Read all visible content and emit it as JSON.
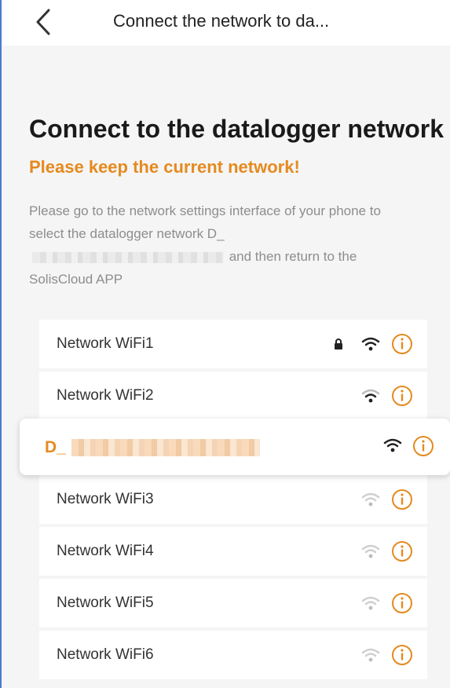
{
  "nav": {
    "title": "Connect the network to da..."
  },
  "main": {
    "heading": "Connect to the datalogger network",
    "warning": "Please keep the current network!",
    "instructions_part1": "Please go to the network settings interface of your phone to select the datalogger network D_",
    "instructions_part2": " and then return to the SolisCloud APP"
  },
  "networks": [
    {
      "label": "Network WiFi1",
      "locked": true,
      "signal_strength": "strong"
    },
    {
      "label": "Network WiFi2",
      "locked": false,
      "signal_strength": "medium"
    },
    {
      "label": "D_",
      "locked": false,
      "signal_strength": "strong",
      "selected": true
    },
    {
      "label": "Network WiFi3",
      "locked": false,
      "signal_strength": "weak"
    },
    {
      "label": "Network WiFi4",
      "locked": false,
      "signal_strength": "weak"
    },
    {
      "label": "Network WiFi5",
      "locked": false,
      "signal_strength": "weak"
    },
    {
      "label": "Network WiFi6",
      "locked": false,
      "signal_strength": "weak"
    }
  ],
  "colors": {
    "accent": "#e58a1f",
    "frame_border": "#4a7bd0"
  },
  "icons": {
    "back": "chevron-left-icon",
    "lock": "lock-icon",
    "wifi": "wifi-icon",
    "info": "info-icon"
  }
}
